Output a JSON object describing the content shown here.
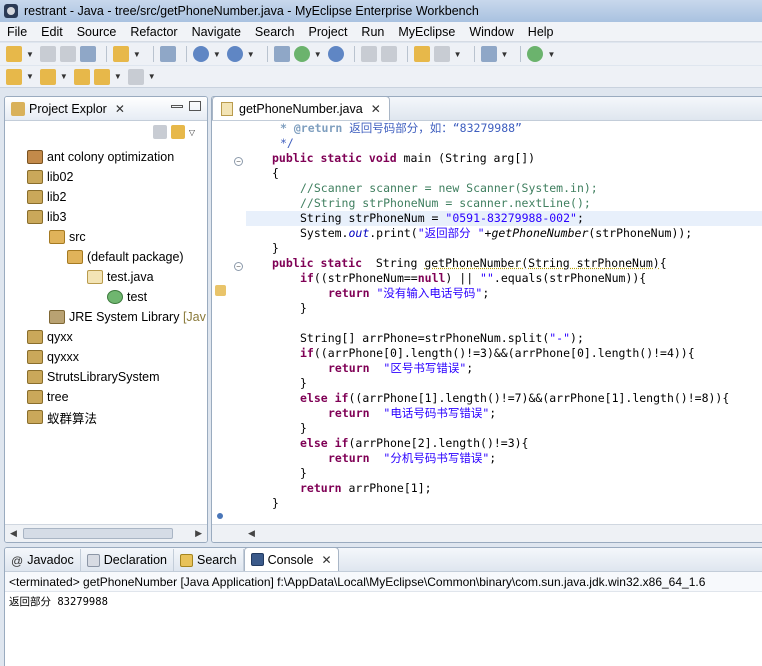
{
  "window": {
    "title": "restrant - Java - tree/src/getPhoneNumber.java - MyEclipse Enterprise Workbench"
  },
  "menubar": [
    "File",
    "Edit",
    "Source",
    "Refactor",
    "Navigate",
    "Search",
    "Project",
    "Run",
    "MyEclipse",
    "Window",
    "Help"
  ],
  "package_explorer": {
    "tab_label": "Project Explor",
    "items": [
      {
        "label": "ant colony optimization",
        "icon": "project-icon",
        "indent": 0
      },
      {
        "label": "lib02",
        "icon": "project-icon",
        "indent": 0
      },
      {
        "label": "lib2",
        "icon": "project-icon",
        "indent": 0
      },
      {
        "label": "lib3",
        "icon": "project-icon",
        "indent": 0
      },
      {
        "label": "src",
        "icon": "source-folder-icon",
        "indent": 1
      },
      {
        "label": "(default package)",
        "icon": "package-icon",
        "indent": 2
      },
      {
        "label": "test.java",
        "icon": "java-file-icon",
        "indent": 3
      },
      {
        "label": "test",
        "icon": "class-icon",
        "indent": 4
      },
      {
        "label": "JRE System Library",
        "suffix": "[Jav",
        "icon": "library-icon",
        "indent": 1
      },
      {
        "label": "qyxx",
        "icon": "project-icon",
        "indent": 0
      },
      {
        "label": "qyxxx",
        "icon": "project-icon",
        "indent": 0
      },
      {
        "label": "StrutsLibrarySystem",
        "icon": "project-icon",
        "indent": 0
      },
      {
        "label": "tree",
        "icon": "project-icon",
        "indent": 0
      },
      {
        "label": "蚁群算法",
        "icon": "project-icon",
        "indent": 0
      }
    ]
  },
  "editor": {
    "tab_label": "getPhoneNumber.java",
    "code": {
      "l1_tag": "* @return",
      "l1_text": "返回号码部分，如：“83279988”",
      "l2": "*/",
      "l3_kw": "public static void",
      "l3_rest": " main (String arg[])",
      "l4": "{",
      "l5": "//Scanner scanner = new Scanner(System.in);",
      "l6": "//String strPhoneNum = scanner.nextLine();",
      "l7_a": "String strPhoneNum = ",
      "l7_str": "\"0591-83279988-002\"",
      "l7_b": ";",
      "l8_a": "System.",
      "l8_out": "out",
      "l8_b": ".print(",
      "l8_str": "\"返回部分 \"",
      "l8_c": "+",
      "l8_call": "getPhoneNumber",
      "l8_d": "(strPhoneNum));",
      "l9": "}",
      "l10_kw": "public static",
      "l10_rest": "  String ",
      "l10_ul": "getPhoneNumber(String strPhoneNum)",
      "l10_end": "{",
      "l11_kw": "if",
      "l11_a": "((strPhoneNum==",
      "l11_null": "null",
      "l11_b": ") || ",
      "l11_str": "\"\"",
      "l11_c": ".equals(strPhoneNum)){",
      "l12_kw": "return",
      "l12_str": " \"没有输入电话号码\"",
      "l12_end": ";",
      "l13": "}",
      "l14": "",
      "l15_a": "String[] arrPhone=strPhoneNum.split(",
      "l15_str": "\"-\"",
      "l15_b": ");",
      "l16_kw": "if",
      "l16_a": "((arrPhone[0].length()!=3)&&(arrPhone[0].length()!=4)){",
      "l17_kw": "return",
      "l17_str": "  \"区号书写错误\"",
      "l17_end": ";",
      "l18": "}",
      "l19_kw": "else if",
      "l19_a": "((arrPhone[1].length()!=7)&&(arrPhone[1].length()!=8)){",
      "l20_kw": "return",
      "l20_str": "  \"电话号码书写错误\"",
      "l20_end": ";",
      "l21": "}",
      "l22_kw": "else if",
      "l22_a": "(arrPhone[2].length()!=3){",
      "l23_kw": "return",
      "l23_str": "  \"分机号码书写错误\"",
      "l23_end": ";",
      "l24": "}",
      "l25_kw": "return",
      "l25_a": " arrPhone[1];",
      "l26": "}"
    }
  },
  "bottom_panel": {
    "tabs": [
      {
        "label": "Javadoc",
        "icon": "at-icon"
      },
      {
        "label": "Declaration",
        "icon": "declaration-icon"
      },
      {
        "label": "Search",
        "icon": "search-icon"
      },
      {
        "label": "Console",
        "icon": "console-icon",
        "active": true
      }
    ],
    "status": "<terminated> getPhoneNumber [Java Application] f:\\AppData\\Local\\MyEclipse\\Common\\binary\\com.sun.java.jdk.win32.x86_64_1.6",
    "output": "返回部分 83279988"
  }
}
